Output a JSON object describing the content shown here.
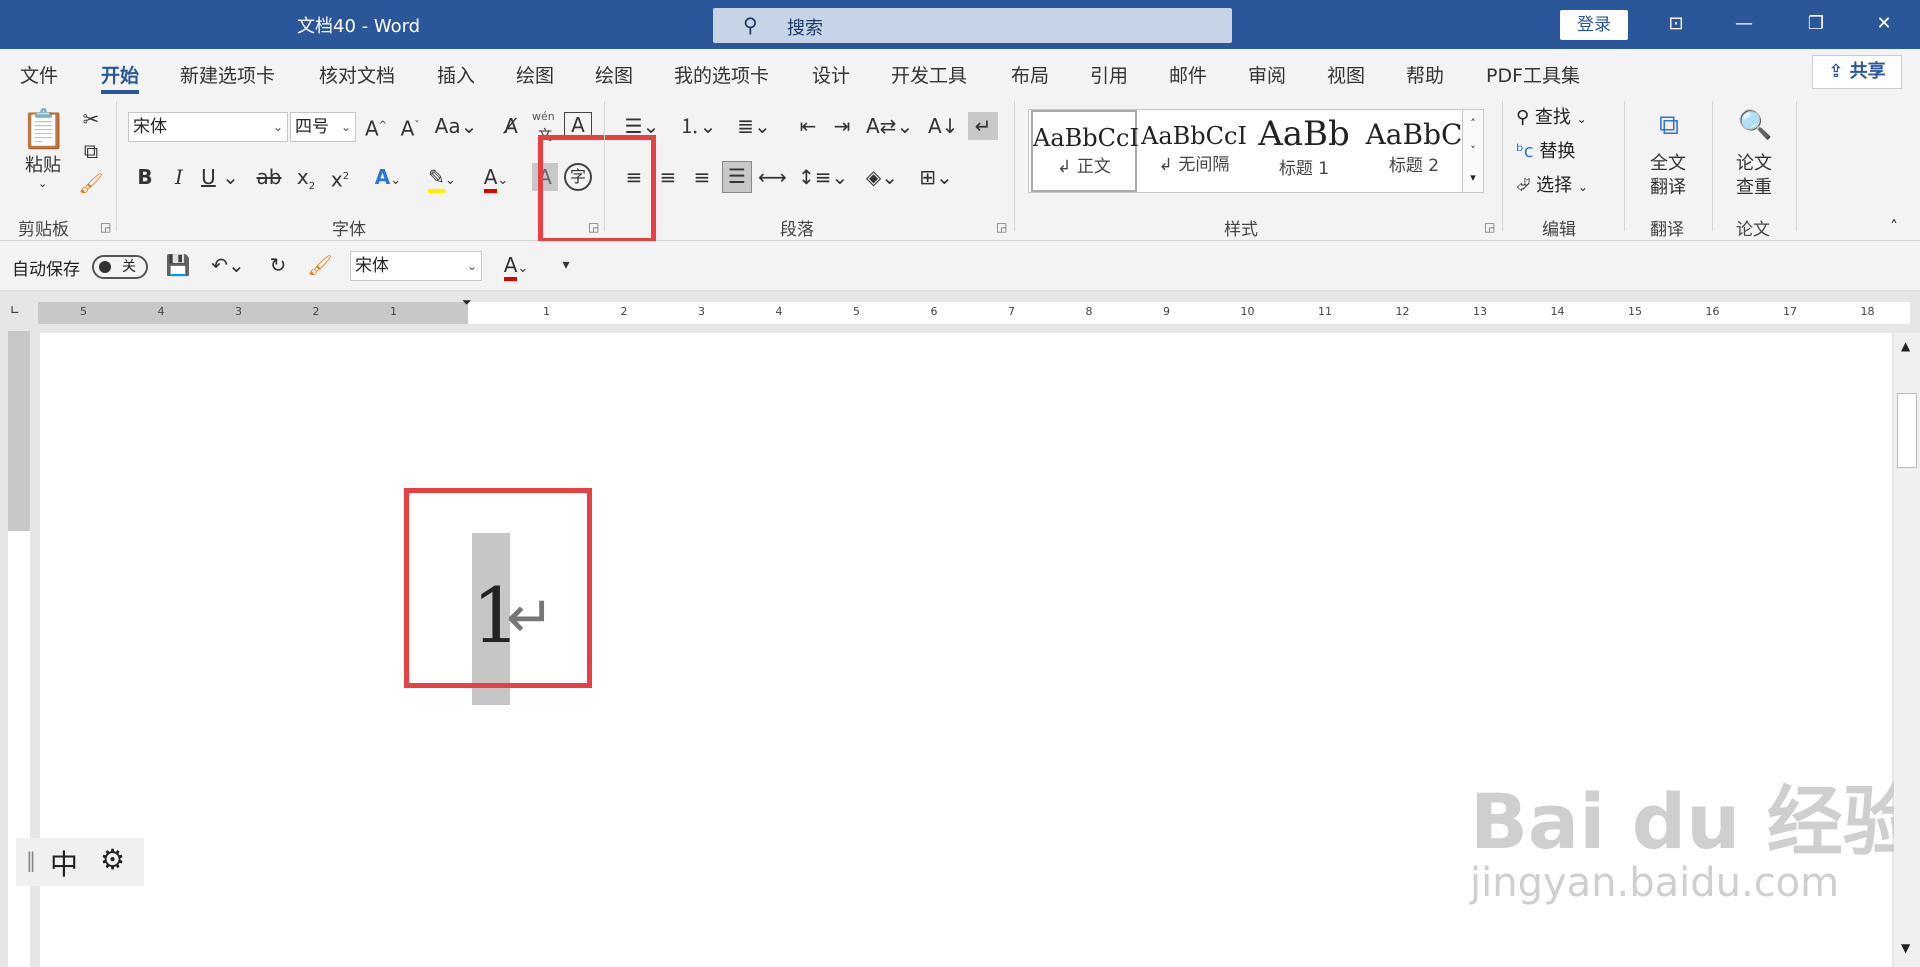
{
  "titlebar": {
    "title": "文档40  -  Word",
    "search_placeholder": "搜索",
    "login": "登录"
  },
  "tabs": [
    "文件",
    "开始",
    "新建选项卡",
    "核对文档",
    "插入",
    "绘图",
    "绘图",
    "我的选项卡",
    "设计",
    "开发工具",
    "布局",
    "引用",
    "邮件",
    "审阅",
    "视图",
    "帮助",
    "PDF工具集"
  ],
  "active_tab": "开始",
  "share": "共享",
  "ribbon": {
    "clipboard": {
      "paste": "粘贴",
      "label": "剪贴板"
    },
    "font": {
      "name": "宋体",
      "size": "四号",
      "label": "字体",
      "wen": "wén"
    },
    "paragraph": {
      "label": "段落"
    },
    "styles": {
      "label": "样式",
      "items": [
        {
          "sample": "AaBbCcI",
          "name": "↲ 正文"
        },
        {
          "sample": "AaBbCcI",
          "name": "↲ 无间隔"
        },
        {
          "sample": "AaBb",
          "name": "标题 1"
        },
        {
          "sample": "AaBbC",
          "name": "标题 2"
        }
      ]
    },
    "editing": {
      "find": "查找",
      "replace": "替换",
      "select": "选择",
      "label": "编辑"
    },
    "translate": {
      "full": "全文",
      "full2": "翻译",
      "label": "翻译"
    },
    "paper": {
      "check": "论文",
      "check2": "查重",
      "label": "论文"
    }
  },
  "qat": {
    "autosave": "自动保存",
    "toggle": "关",
    "font": "宋体"
  },
  "ruler": {
    "h_left": [
      "5",
      "4",
      "3",
      "2",
      "1"
    ],
    "h_right": [
      "1",
      "2",
      "3",
      "4",
      "5",
      "6",
      "7",
      "8",
      "9",
      "10",
      "11",
      "12",
      "13",
      "14",
      "15",
      "16",
      "17",
      "18"
    ]
  },
  "document": {
    "text": "1",
    "mark": "↵"
  },
  "ime": {
    "mode": "中"
  },
  "watermark": {
    "main": "Bai du 经验",
    "sub": "jingyan.baidu.com"
  }
}
